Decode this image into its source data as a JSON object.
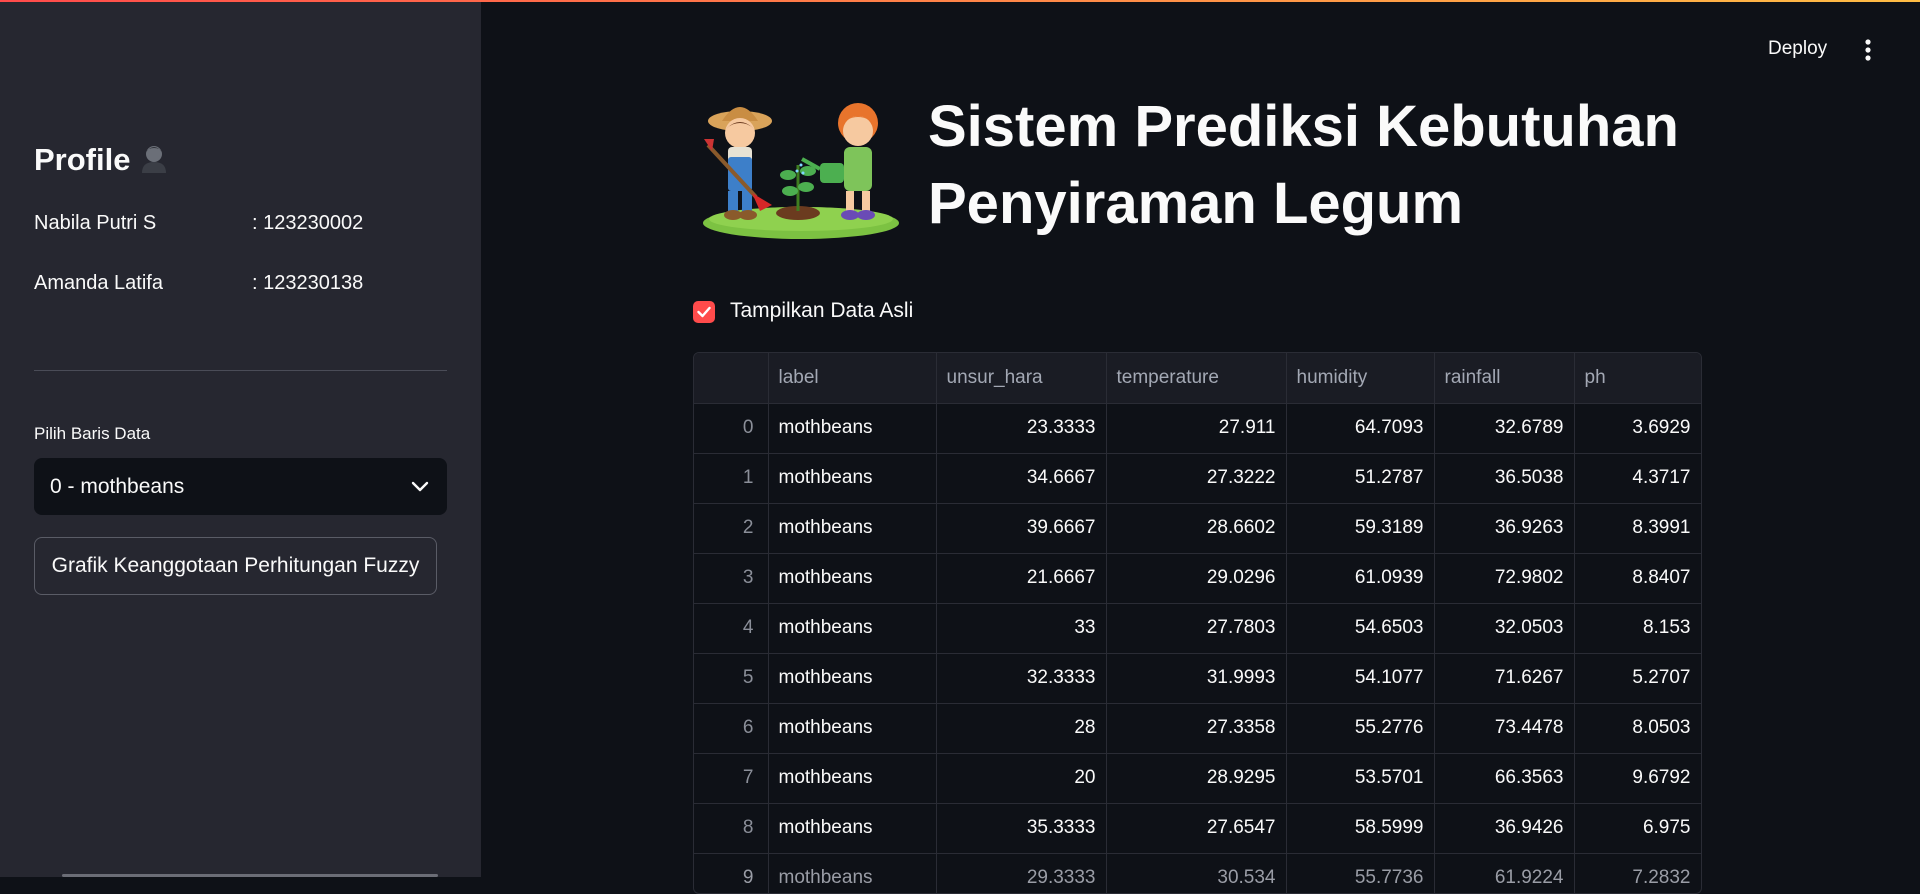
{
  "header": {
    "deploy_label": "Deploy",
    "menu_icon": "kebab-menu-icon"
  },
  "sidebar": {
    "profile_title": "Profile",
    "profile_icon": "person-icon",
    "members": [
      {
        "name": "Nabila Putri S",
        "id": ": 123230002"
      },
      {
        "name": "Amanda Latifa",
        "id": ": 123230138"
      }
    ],
    "select_label": "Pilih Baris Data",
    "select_value": "0 - mothbeans",
    "button_label": "Grafik Keanggotaan Perhitungan Fuzzy"
  },
  "main": {
    "title": "Sistem Prediksi Kebutuhan Penyiraman Legum",
    "hero_image": "kids-gardening-illustration",
    "checkbox_label": "Tampilkan Data Asli",
    "checkbox_checked": true,
    "table": {
      "columns": [
        "",
        "label",
        "unsur_hara",
        "temperature",
        "humidity",
        "rainfall",
        "ph"
      ],
      "rows": [
        [
          "0",
          "mothbeans",
          "23.3333",
          "27.911",
          "64.7093",
          "32.6789",
          "3.6929"
        ],
        [
          "1",
          "mothbeans",
          "34.6667",
          "27.3222",
          "51.2787",
          "36.5038",
          "4.3717"
        ],
        [
          "2",
          "mothbeans",
          "39.6667",
          "28.6602",
          "59.3189",
          "36.9263",
          "8.3991"
        ],
        [
          "3",
          "mothbeans",
          "21.6667",
          "29.0296",
          "61.0939",
          "72.9802",
          "8.8407"
        ],
        [
          "4",
          "mothbeans",
          "33",
          "27.7803",
          "54.6503",
          "32.0503",
          "8.153"
        ],
        [
          "5",
          "mothbeans",
          "32.3333",
          "31.9993",
          "54.1077",
          "71.6267",
          "5.2707"
        ],
        [
          "6",
          "mothbeans",
          "28",
          "27.3358",
          "55.2776",
          "73.4478",
          "8.0503"
        ],
        [
          "7",
          "mothbeans",
          "20",
          "28.9295",
          "53.5701",
          "66.3563",
          "9.6792"
        ],
        [
          "8",
          "mothbeans",
          "35.3333",
          "27.6547",
          "58.5999",
          "36.9426",
          "6.975"
        ],
        [
          "9",
          "mothbeans",
          "29.3333",
          "30.534",
          "55.7736",
          "61.9224",
          "7.2832"
        ]
      ]
    }
  },
  "colors": {
    "accent": "#ff4b4b",
    "background": "#0e1117",
    "sidebar": "#262730"
  }
}
